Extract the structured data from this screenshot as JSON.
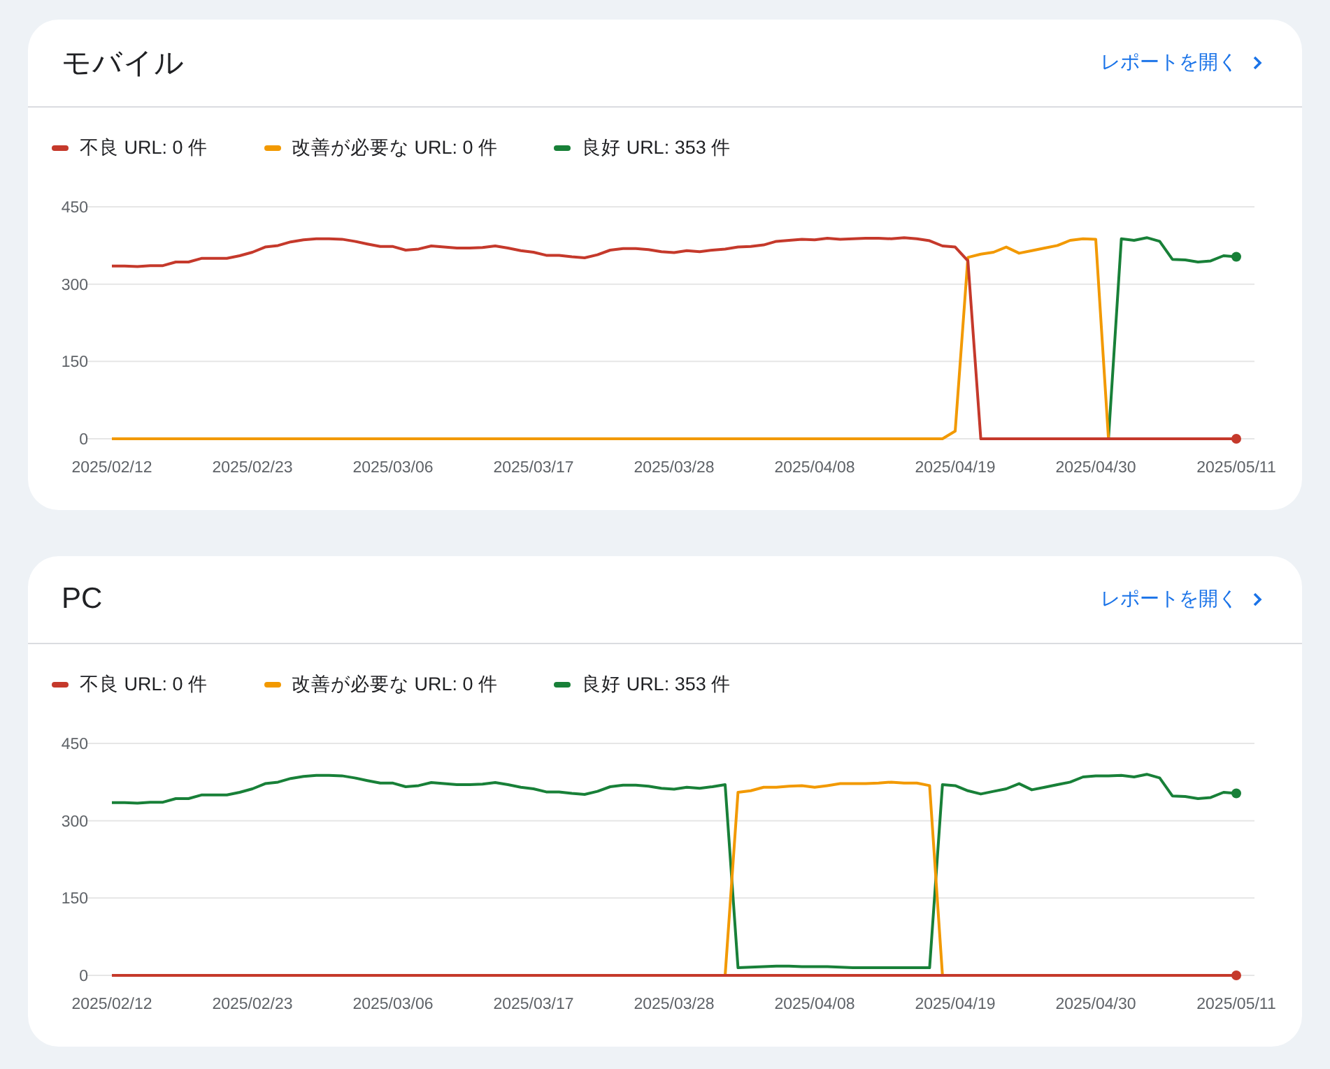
{
  "cards": [
    {
      "title": "モバイル",
      "link": "レポートを開く",
      "chart_data": {
        "type": "line",
        "ylim": [
          0,
          450
        ],
        "yticks": [
          0,
          150,
          300,
          450
        ],
        "categories": [
          "2025/02/12",
          null,
          null,
          null,
          null,
          null,
          null,
          null,
          null,
          null,
          null,
          "2025/02/23",
          null,
          null,
          null,
          null,
          null,
          null,
          null,
          null,
          null,
          null,
          "2025/03/06",
          null,
          null,
          null,
          null,
          null,
          null,
          null,
          null,
          null,
          null,
          "2025/03/17",
          null,
          null,
          null,
          null,
          null,
          null,
          null,
          null,
          null,
          null,
          "2025/03/28",
          null,
          null,
          null,
          null,
          null,
          null,
          null,
          null,
          null,
          null,
          "2025/04/08",
          null,
          null,
          null,
          null,
          null,
          null,
          null,
          null,
          null,
          null,
          "2025/04/19",
          null,
          null,
          null,
          null,
          null,
          null,
          null,
          null,
          null,
          null,
          "2025/04/30",
          null,
          null,
          null,
          null,
          null,
          null,
          null,
          null,
          null,
          null,
          "2025/05/11"
        ],
        "series": [
          {
            "name": "不良 URL: 0 件",
            "color": "#c5392b",
            "values": [
              335,
              335,
              334,
              336,
              336,
              343,
              343,
              350,
              350,
              350,
              355,
              362,
              372,
              375,
              382,
              386,
              388,
              388,
              387,
              383,
              378,
              373,
              373,
              366,
              368,
              374,
              372,
              370,
              370,
              371,
              374,
              370,
              365,
              362,
              356,
              356,
              353,
              351,
              357,
              366,
              369,
              369,
              367,
              363,
              361,
              365,
              363,
              366,
              368,
              372,
              373,
              376,
              383,
              385,
              387,
              386,
              389,
              387,
              388,
              389,
              389,
              388,
              390,
              388,
              384,
              374,
              372,
              345,
              0,
              0,
              0,
              0,
              0,
              0,
              0,
              0,
              0,
              0,
              0,
              0,
              0,
              0,
              0,
              0,
              0,
              0,
              0,
              0,
              0
            ]
          },
          {
            "name": "改善が必要な URL: 0 件",
            "color": "#f29900",
            "values": [
              0,
              0,
              0,
              0,
              0,
              0,
              0,
              0,
              0,
              0,
              0,
              0,
              0,
              0,
              0,
              0,
              0,
              0,
              0,
              0,
              0,
              0,
              0,
              0,
              0,
              0,
              0,
              0,
              0,
              0,
              0,
              0,
              0,
              0,
              0,
              0,
              0,
              0,
              0,
              0,
              0,
              0,
              0,
              0,
              0,
              0,
              0,
              0,
              0,
              0,
              0,
              0,
              0,
              0,
              0,
              0,
              0,
              0,
              0,
              0,
              0,
              0,
              0,
              0,
              0,
              0,
              15,
              352,
              358,
              362,
              372,
              360,
              365,
              370,
              375,
              385,
              388,
              387,
              0,
              null,
              null,
              null,
              null,
              null,
              null,
              null,
              null,
              null,
              null
            ]
          },
          {
            "name": "良好 URL: 353 件",
            "color": "#188038",
            "values": [
              null,
              null,
              null,
              null,
              null,
              null,
              null,
              null,
              null,
              null,
              null,
              null,
              null,
              null,
              null,
              null,
              null,
              null,
              null,
              null,
              null,
              null,
              null,
              null,
              null,
              null,
              null,
              null,
              null,
              null,
              null,
              null,
              null,
              null,
              null,
              null,
              null,
              null,
              null,
              null,
              null,
              null,
              null,
              null,
              null,
              null,
              null,
              null,
              null,
              null,
              null,
              null,
              null,
              null,
              null,
              null,
              null,
              null,
              null,
              null,
              null,
              null,
              null,
              null,
              null,
              null,
              null,
              null,
              null,
              null,
              null,
              null,
              null,
              null,
              null,
              null,
              null,
              null,
              0,
              388,
              385,
              390,
              383,
              348,
              347,
              343,
              345,
              355,
              353
            ]
          }
        ]
      }
    },
    {
      "title": "PC",
      "link": "レポートを開く",
      "chart_data": {
        "type": "line",
        "ylim": [
          0,
          450
        ],
        "yticks": [
          0,
          150,
          300,
          450
        ],
        "categories": [
          "2025/02/12",
          null,
          null,
          null,
          null,
          null,
          null,
          null,
          null,
          null,
          null,
          "2025/02/23",
          null,
          null,
          null,
          null,
          null,
          null,
          null,
          null,
          null,
          null,
          "2025/03/06",
          null,
          null,
          null,
          null,
          null,
          null,
          null,
          null,
          null,
          null,
          "2025/03/17",
          null,
          null,
          null,
          null,
          null,
          null,
          null,
          null,
          null,
          null,
          "2025/03/28",
          null,
          null,
          null,
          null,
          null,
          null,
          null,
          null,
          null,
          null,
          "2025/04/08",
          null,
          null,
          null,
          null,
          null,
          null,
          null,
          null,
          null,
          null,
          "2025/04/19",
          null,
          null,
          null,
          null,
          null,
          null,
          null,
          null,
          null,
          null,
          "2025/04/30",
          null,
          null,
          null,
          null,
          null,
          null,
          null,
          null,
          null,
          null,
          "2025/05/11"
        ],
        "series": [
          {
            "name": "不良 URL: 0 件",
            "color": "#c5392b",
            "values": [
              0,
              0,
              0,
              0,
              0,
              0,
              0,
              0,
              0,
              0,
              0,
              0,
              0,
              0,
              0,
              0,
              0,
              0,
              0,
              0,
              0,
              0,
              0,
              0,
              0,
              0,
              0,
              0,
              0,
              0,
              0,
              0,
              0,
              0,
              0,
              0,
              0,
              0,
              0,
              0,
              0,
              0,
              0,
              0,
              0,
              0,
              0,
              0,
              0,
              0,
              0,
              0,
              0,
              0,
              0,
              0,
              0,
              0,
              0,
              0,
              0,
              0,
              0,
              0,
              0,
              0,
              0,
              0,
              0,
              0,
              0,
              0,
              0,
              0,
              0,
              0,
              0,
              0,
              0,
              0,
              0,
              0,
              0,
              0,
              0,
              0,
              0,
              0,
              0
            ]
          },
          {
            "name": "改善が必要な URL: 0 件",
            "color": "#f29900",
            "values": [
              null,
              null,
              null,
              null,
              null,
              null,
              null,
              null,
              null,
              null,
              null,
              null,
              null,
              null,
              null,
              null,
              null,
              null,
              null,
              null,
              null,
              null,
              null,
              null,
              null,
              null,
              null,
              null,
              null,
              null,
              null,
              null,
              null,
              null,
              null,
              null,
              null,
              null,
              null,
              null,
              null,
              null,
              null,
              null,
              null,
              null,
              null,
              null,
              0,
              355,
              358,
              365,
              365,
              367,
              368,
              365,
              368,
              372,
              372,
              372,
              373,
              375,
              373,
              373,
              368,
              0,
              null,
              null,
              null,
              null,
              null,
              null,
              null,
              null,
              null,
              null,
              null,
              null,
              null,
              null,
              null,
              null,
              null,
              null,
              null,
              null,
              null,
              null,
              null
            ]
          },
          {
            "name": "良好 URL: 353 件",
            "color": "#188038",
            "values": [
              335,
              335,
              334,
              336,
              336,
              343,
              343,
              350,
              350,
              350,
              355,
              362,
              372,
              375,
              382,
              386,
              388,
              388,
              387,
              383,
              378,
              373,
              373,
              366,
              368,
              374,
              372,
              370,
              370,
              371,
              374,
              370,
              365,
              362,
              356,
              356,
              353,
              351,
              357,
              366,
              369,
              369,
              367,
              363,
              361,
              365,
              363,
              366,
              370,
              15,
              16,
              17,
              18,
              18,
              17,
              17,
              17,
              16,
              15,
              15,
              15,
              15,
              15,
              15,
              15,
              370,
              368,
              358,
              352,
              357,
              362,
              372,
              360,
              365,
              370,
              375,
              385,
              387,
              387,
              388,
              385,
              390,
              383,
              348,
              347,
              343,
              345,
              355,
              353
            ]
          }
        ]
      }
    }
  ]
}
